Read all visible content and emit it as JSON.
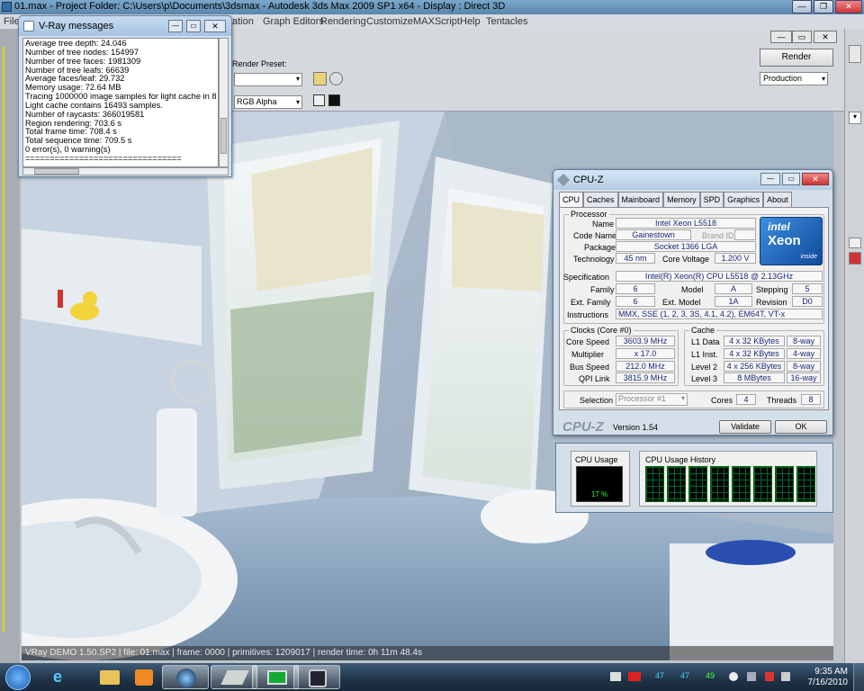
{
  "app": {
    "title": "01.max    - Project Folder: C:\\Users\\p\\Documents\\3dsmax    - Autodesk 3ds Max  2009 SP1  x64    - Display : Direct 3D",
    "menu": [
      "File",
      "Graph Editors",
      "Rendering",
      "Customize",
      "MAXScript",
      "Help",
      "Tentacles"
    ],
    "menu_partial": "ation",
    "render_preset_label": "Render Preset:",
    "render_button": "Render",
    "production_select": "Production",
    "channel_select": "RGB Alpha"
  },
  "statusbar": "VRay DEMO 1.50.SP2  |  file: 01.max  |  frame: 0000  |  primitives: 1209017  |  render time: 0h 11m 48.4s",
  "vray": {
    "title": "V-Ray messages",
    "lines": [
      "Average tree depth: 24.046",
      "Number of tree nodes: 154997",
      "Number of tree faces: 1981309",
      "Number of tree leafs: 66639",
      "Average faces/leaf: 29.732",
      "Memory usage: 72.64 MB",
      "Tracing 1000000 image samples for light cache in 8 passes.",
      "Light cache contains 16493 samples.",
      "Number of raycasts: 366019581",
      "Region rendering: 703.6 s",
      "Total frame time: 708.4 s",
      "Total sequence time: 709.5 s",
      "0 error(s), 0 warning(s)",
      "================================"
    ]
  },
  "cpuz": {
    "title": "CPU-Z",
    "tabs": [
      "CPU",
      "Caches",
      "Mainboard",
      "Memory",
      "SPD",
      "Graphics",
      "About"
    ],
    "processor_label": "Processor",
    "name_label": "Name",
    "name": "Intel Xeon L5518",
    "codename_label": "Code Name",
    "codename": "Gainestown",
    "brandid_label": "Brand ID",
    "package_label": "Package",
    "package": "Socket 1366 LGA",
    "technology_label": "Technology",
    "technology": "45 nm",
    "corevoltage_label": "Core Voltage",
    "corevoltage": "1.200 V",
    "spec_label": "Specification",
    "spec": "Intel(R) Xeon(R) CPU         L5518  @ 2.13GHz",
    "family_label": "Family",
    "family": "6",
    "model_label": "Model",
    "model": "A",
    "stepping_label": "Stepping",
    "stepping": "5",
    "extfamily_label": "Ext. Family",
    "extfamily": "6",
    "extmodel_label": "Ext. Model",
    "extmodel": "1A",
    "revision_label": "Revision",
    "revision": "D0",
    "instr_label": "Instructions",
    "instr": "MMX, SSE (1, 2, 3, 3S, 4.1, 4.2), EM64T, VT-x",
    "clocks_label": "Clocks (Core #0)",
    "corespeed_label": "Core Speed",
    "corespeed": "3603.9 MHz",
    "multiplier_label": "Multiplier",
    "multiplier": "x 17.0",
    "busspeed_label": "Bus Speed",
    "busspeed": "212.0 MHz",
    "qpi_label": "QPI Link",
    "qpi": "3815.9 MHz",
    "cache_label": "Cache",
    "l1data_label": "L1 Data",
    "l1data": "4 x 32 KBytes",
    "l1data_way": "8-way",
    "l1inst_label": "L1 Inst.",
    "l1inst": "4 x 32 KBytes",
    "l1inst_way": "4-way",
    "l2_label": "Level 2",
    "l2": "4 x 256 KBytes",
    "l2_way": "8-way",
    "l3_label": "Level 3",
    "l3": "8 MBytes",
    "l3_way": "16-way",
    "selection_label": "Selection",
    "selection": "Processor #1",
    "cores_label": "Cores",
    "cores": "4",
    "threads_label": "Threads",
    "threads": "8",
    "brand": "CPU-Z",
    "version": "Version 1.54",
    "validate": "Validate",
    "ok": "OK",
    "intel_logo": "intel",
    "xeon_logo": "Xeon",
    "inside_logo": "inside"
  },
  "usage": {
    "cpu_usage_label": "CPU Usage",
    "cpu_usage_value": "17 %",
    "history_label": "CPU Usage History",
    "history_cores": 8
  },
  "taskbar": {
    "time": "9:35 AM",
    "date": "7/16/2010",
    "tray_numbers": [
      "47",
      "47",
      "49"
    ]
  },
  "colors": {
    "titlebar": "#6d99c0",
    "taskbar": "#1f3346",
    "cpuz_value": "#1c2a7a",
    "intel_blue": "#1f6fc2"
  }
}
